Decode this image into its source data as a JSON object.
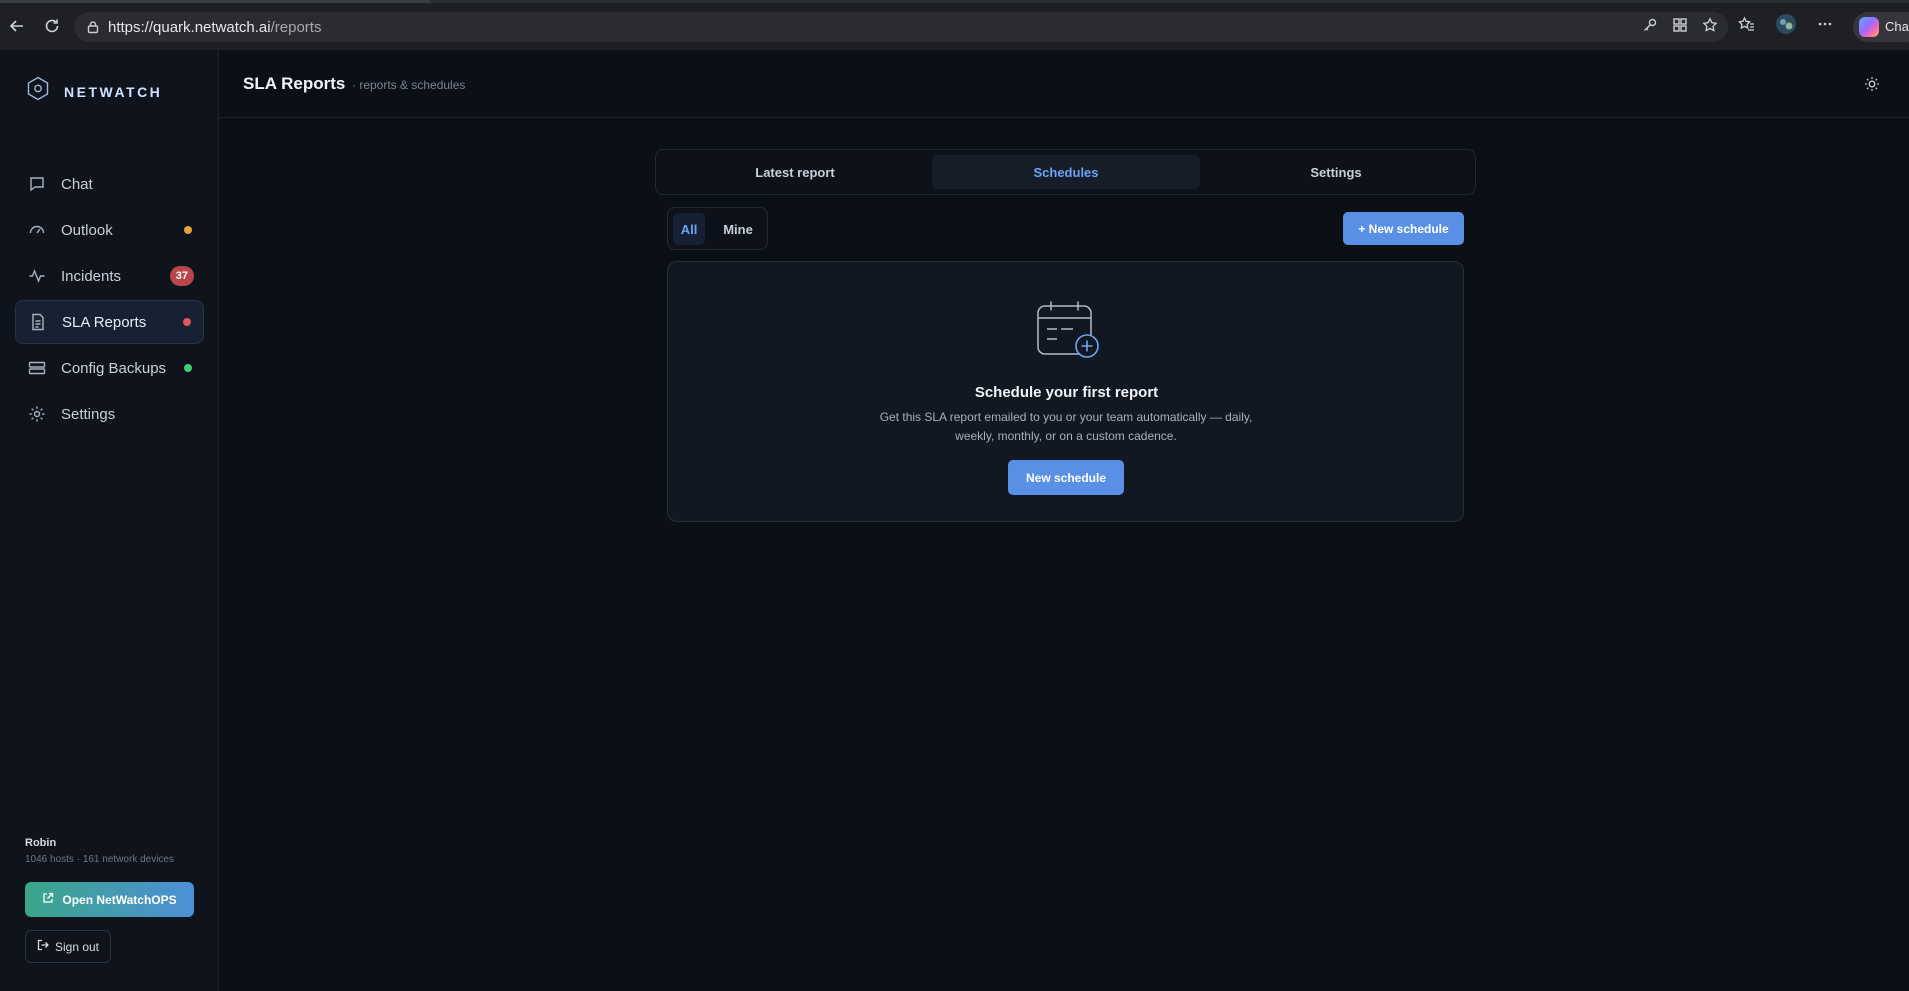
{
  "browser": {
    "url_host": "https://quark.netwatch.ai",
    "url_path": "/reports",
    "chat_label": "Chat"
  },
  "brand": {
    "name": "NETWATCH"
  },
  "sidebar": {
    "items": [
      {
        "label": "Chat",
        "icon": "chat-icon"
      },
      {
        "label": "Outlook",
        "icon": "gauge-icon",
        "dot_color": "#e8a23a"
      },
      {
        "label": "Incidents",
        "icon": "activity-icon",
        "badge": "37"
      },
      {
        "label": "SLA Reports",
        "icon": "document-icon",
        "dot_color": "#e0575c",
        "active": true
      },
      {
        "label": "Config Backups",
        "icon": "server-icon",
        "dot_color": "#3ecf6e"
      },
      {
        "label": "Settings",
        "icon": "gear-icon"
      }
    ],
    "user": {
      "name": "Robin",
      "summary": "1046 hosts · 161 network devices"
    },
    "ops_button": "Open NetWatchOPS",
    "signout_button": "Sign out"
  },
  "header": {
    "title": "SLA Reports",
    "subtitle": "· reports & schedules"
  },
  "tabs": [
    {
      "label": "Latest report"
    },
    {
      "label": "Schedules",
      "active": true
    },
    {
      "label": "Settings"
    }
  ],
  "filter": {
    "options": [
      "All",
      "Mine"
    ],
    "selected": "All"
  },
  "new_schedule_button": "+ New schedule",
  "empty_state": {
    "title": "Schedule your first report",
    "description": "Get this SLA report emailed to you or your team automatically — daily, weekly, monthly, or on a custom cadence.",
    "button": "New schedule"
  },
  "colors": {
    "accent": "#5a8fe6",
    "active_text": "#6fa3f5",
    "badge": "#b8454b"
  }
}
